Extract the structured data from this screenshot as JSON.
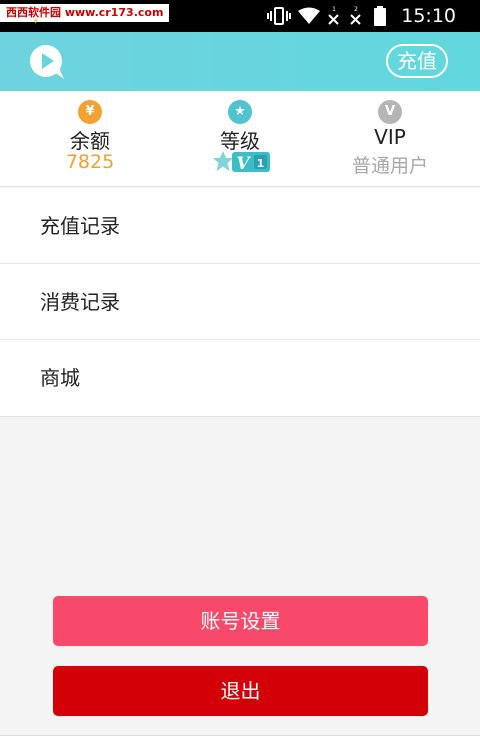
{
  "status_bar": {
    "watermark": "西西软件园 www.cr173.com",
    "time": "15:10",
    "icons": [
      "vibrate-icon",
      "wifi-icon",
      "sim1-no-signal-icon",
      "sim2-no-signal-icon",
      "battery-icon"
    ]
  },
  "header": {
    "logo": "app-logo-icon",
    "recharge_label": "充值",
    "gradient": [
      "#6ed3df",
      "#62d7dd"
    ]
  },
  "stats": {
    "balance": {
      "icon_text": "¥",
      "label": "余额",
      "value": "7825",
      "color": "#f0a233"
    },
    "level": {
      "icon_text": "★",
      "label": "等级",
      "badge_text": "V",
      "badge_level": "1",
      "color": "#4fc4cf"
    },
    "vip": {
      "icon_text": "V",
      "label": "VIP",
      "value": "普通用户",
      "color": "#b5b5b5"
    }
  },
  "menu": {
    "items": [
      {
        "label": "充值记录"
      },
      {
        "label": "消费记录"
      },
      {
        "label": "商城"
      }
    ]
  },
  "buttons": {
    "settings_label": "账号设置",
    "settings_color": "#f9496b",
    "logout_label": "退出",
    "logout_color": "#d40008"
  }
}
